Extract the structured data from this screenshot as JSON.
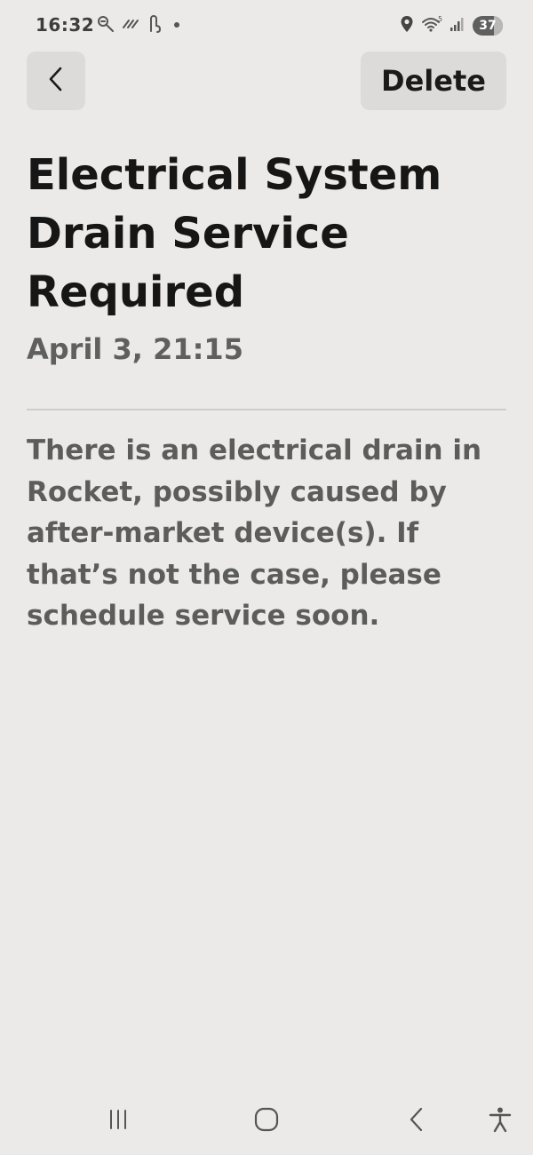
{
  "status_bar": {
    "time": "16:32",
    "battery": "37",
    "icons": [
      "flashlight-icon",
      "nfc-icon",
      "hearing-aid-icon",
      "notification-dot-icon",
      "location-icon",
      "wifi-icon",
      "signal-icon",
      "battery-icon"
    ]
  },
  "header": {
    "back_icon": "chevron-left-icon",
    "delete_label": "Delete"
  },
  "message": {
    "title": "Electrical System Drain Service Required",
    "timestamp": "April 3, 21:15",
    "body": "There is an electrical drain in Rocket, possibly caused by after-market device(s). If that’s not the case, please schedule service soon."
  },
  "nav_bar": {
    "icons": [
      "recent-apps-icon",
      "home-icon",
      "back-icon",
      "accessibility-icon"
    ]
  }
}
